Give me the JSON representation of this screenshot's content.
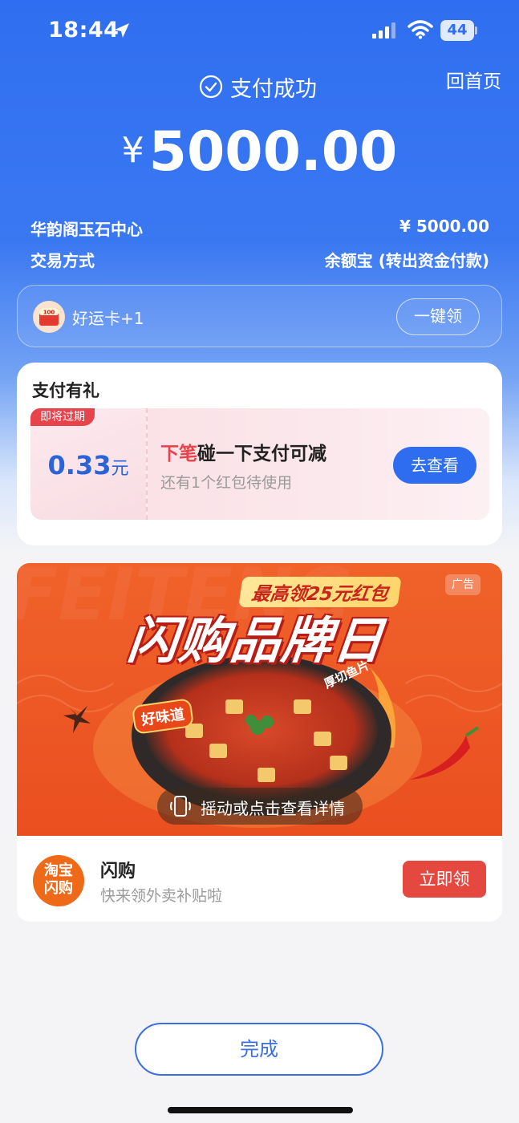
{
  "status_bar": {
    "time": "18:44",
    "battery": "44"
  },
  "header": {
    "title": "支付成功",
    "home_link": "回首页"
  },
  "payment": {
    "currency_symbol": "¥",
    "amount": "5000.00",
    "merchant_label": "华韵阁玉石中心",
    "merchant_amount": "¥ 5000.00",
    "method_label": "交易方式",
    "method_value": "余额宝 (转出资金付款)"
  },
  "lucky": {
    "icon_text": "100",
    "label": "好运卡+1",
    "button": "一键领"
  },
  "gift": {
    "title": "支付有礼",
    "expiry_tag": "即将过期",
    "amount": "0.33",
    "unit": "元",
    "headline_highlight": "下笔",
    "headline_rest": "碰一下支付可减",
    "sub": "还有1个红包待使用",
    "button": "去查看"
  },
  "ad": {
    "tag": "广告",
    "top_text": "最高领25元红包",
    "title": "闪购品牌日",
    "badge_left": "好味道",
    "badge_right": "厚切鱼片",
    "shake_text": "摇动或点击查看详情",
    "brand_logo_line1": "淘宝",
    "brand_logo_line2": "闪购",
    "brand_name": "闪购",
    "brand_sub": "快来领外卖补贴啦",
    "claim_button": "立即领"
  },
  "footer": {
    "done_button": "完成"
  },
  "colors": {
    "primary_blue": "#2e6df0",
    "red": "#e8424a",
    "ad_orange": "#ef5a26"
  }
}
